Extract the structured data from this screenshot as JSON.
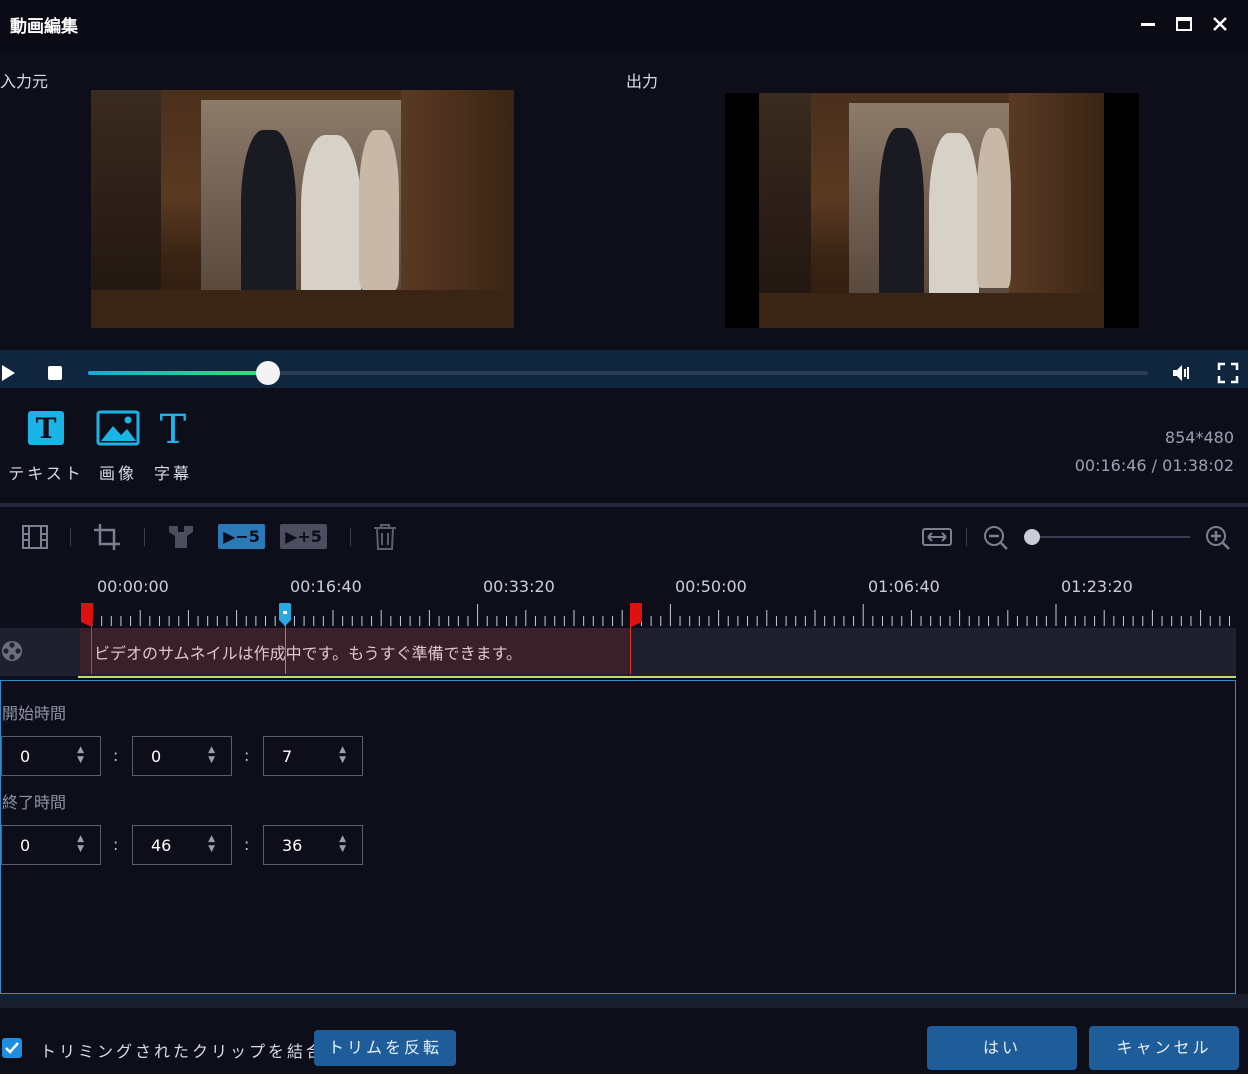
{
  "window": {
    "title": "動画編集",
    "minimize": "—",
    "maximize": "▢",
    "close": "✕"
  },
  "preview": {
    "input_label": "入力元",
    "output_label": "出力"
  },
  "tools": [
    {
      "label": "テキスト",
      "icon": "text-tool-icon"
    },
    {
      "label": "画像",
      "icon": "image-tool-icon"
    },
    {
      "label": "字幕",
      "icon": "subtitle-tool-icon"
    }
  ],
  "info": {
    "resolution": "854*480",
    "time": "00:16:46 / 01:38:02"
  },
  "playback": {
    "progress": 0.17
  },
  "edit_toolbar": {
    "minus5": "−5",
    "plus5": "+5"
  },
  "timeline": {
    "ticks": [
      "00:00:00",
      "00:16:40",
      "00:33:20",
      "00:50:00",
      "01:06:40",
      "01:23:20"
    ],
    "clip_text": "ビデオのサムネイルは作成中です。もうすぐ準備できます。"
  },
  "time_panel": {
    "start_label": "開始時間",
    "start": {
      "h": "0",
      "m": "0",
      "s": "7"
    },
    "end_label": "終了時間",
    "end": {
      "h": "0",
      "m": "46",
      "s": "36"
    },
    "colon": ":",
    "arrows": "▲\n▼"
  },
  "footer": {
    "merge_label": "トリミングされたクリップを結合",
    "merge_checked": true,
    "invert_button": "トリムを反転",
    "yes_button": "はい",
    "cancel_button": "キャンセル"
  },
  "colors": {
    "accent": "#1e8fe0",
    "marker_red": "#e01010",
    "playhead": "#2aa8e0",
    "button": "#1e5c9a"
  }
}
